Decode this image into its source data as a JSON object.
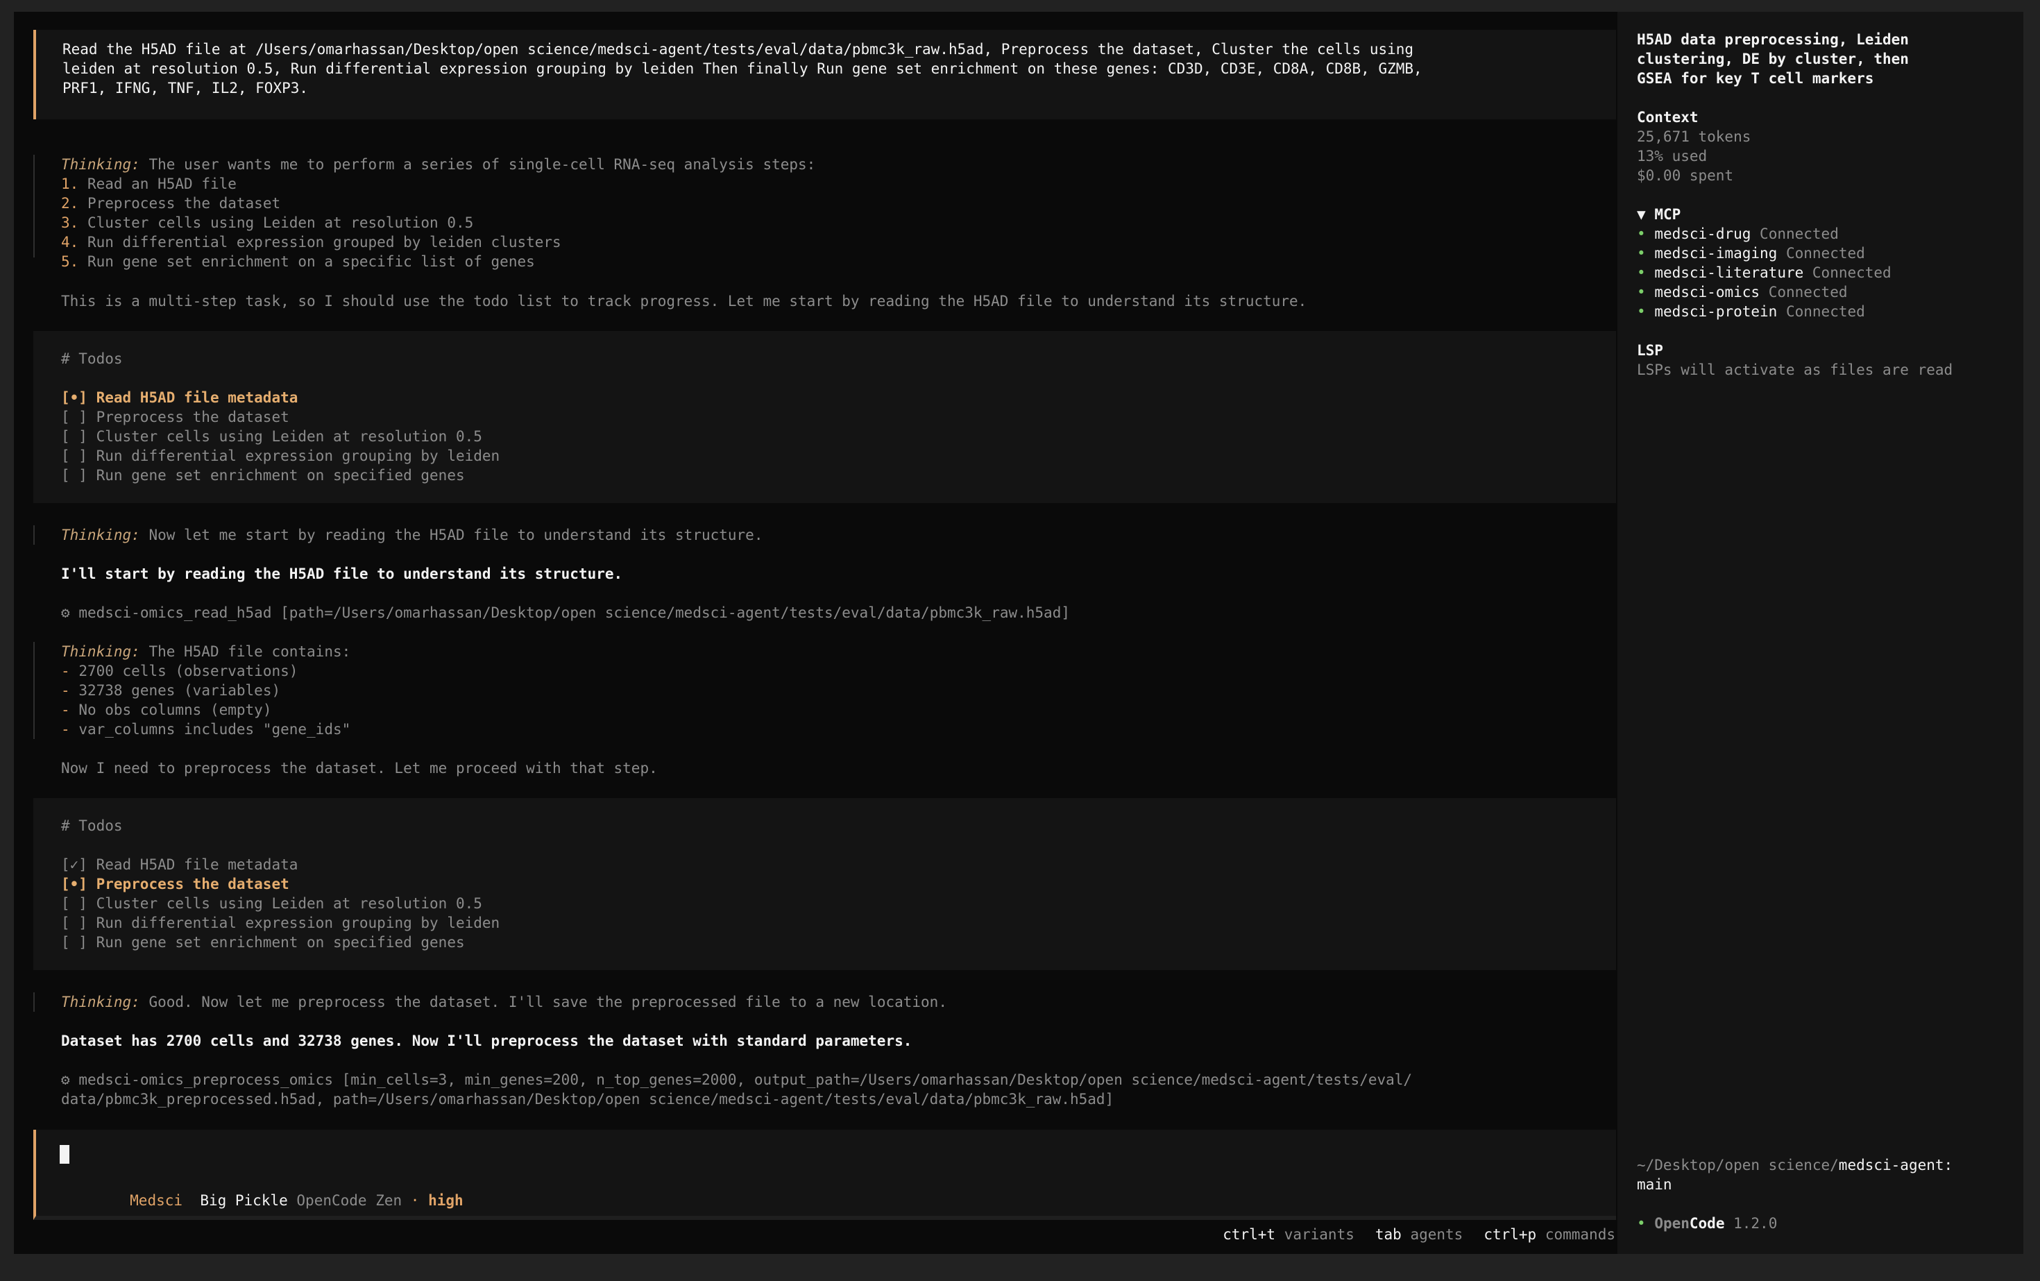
{
  "prompt": {
    "line1": "Read the H5AD file at /Users/omarhassan/Desktop/open science/medsci-agent/tests/eval/data/pbmc3k_raw.h5ad, Preprocess the dataset, Cluster the cells using",
    "line2": "leiden at resolution 0.5, Run differential expression grouping by leiden Then finally Run gene set enrichment on these genes: CD3D, CD3E, CD8A, CD8B, GZMB,",
    "line3": "PRF1, IFNG, TNF, IL2, FOXP3."
  },
  "thinking_label": "Thinking:",
  "thinking1": {
    "intro": "The user wants me to perform a series of single-cell RNA-seq analysis steps:",
    "steps": [
      {
        "num": "1.",
        "text": "Read an H5AD file"
      },
      {
        "num": "2.",
        "text": "Preprocess the dataset"
      },
      {
        "num": "3.",
        "text": "Cluster cells using Leiden at resolution 0.5"
      },
      {
        "num": "4.",
        "text": "Run differential expression grouped by leiden clusters"
      },
      {
        "num": "5.",
        "text": "Run gene set enrichment on a specific list of genes"
      }
    ],
    "outro": "This is a multi-step task, so I should use the todo list to track progress. Let me start by reading the H5AD file to understand its structure."
  },
  "todos1": {
    "header": "# Todos",
    "items": [
      {
        "mark": "[•]",
        "text": "Read H5AD file metadata"
      },
      {
        "mark": "[ ]",
        "text": "Preprocess the dataset"
      },
      {
        "mark": "[ ]",
        "text": "Cluster cells using Leiden at resolution 0.5"
      },
      {
        "mark": "[ ]",
        "text": "Run differential expression grouping by leiden"
      },
      {
        "mark": "[ ]",
        "text": "Run gene set enrichment on specified genes"
      }
    ]
  },
  "thinking2": {
    "text": "Now let me start by reading the H5AD file to understand its structure.",
    "reply": "I'll start by reading the H5AD file to understand its structure.",
    "tool_icon": "⚙",
    "tool": "medsci-omics_read_h5ad [path=/Users/omarhassan/Desktop/open science/medsci-agent/tests/eval/data/pbmc3k_raw.h5ad]"
  },
  "thinking3": {
    "intro": "The H5AD file contains:",
    "bullet": "-",
    "items": [
      "2700 cells (observations)",
      "32738 genes (variables)",
      "No obs columns (empty)",
      "var_columns includes \"gene_ids\""
    ],
    "outro": "Now I need to preprocess the dataset. Let me proceed with that step."
  },
  "todos2": {
    "header": "# Todos",
    "items": [
      {
        "mark": "[✓]",
        "text": "Read H5AD file metadata"
      },
      {
        "mark": "[•]",
        "text": "Preprocess the dataset"
      },
      {
        "mark": "[ ]",
        "text": "Cluster cells using Leiden at resolution 0.5"
      },
      {
        "mark": "[ ]",
        "text": "Run differential expression grouping by leiden"
      },
      {
        "mark": "[ ]",
        "text": "Run gene set enrichment on specified genes"
      }
    ]
  },
  "thinking4": {
    "text": "Good. Now let me preprocess the dataset. I'll save the preprocessed file to a new location.",
    "reply": "Dataset has 2700 cells and 32738 genes. Now I'll preprocess the dataset with standard parameters.",
    "tool_icon": "⚙",
    "tool_line1": "medsci-omics_preprocess_omics [min_cells=3, min_genes=200, n_top_genes=2000, output_path=/Users/omarhassan/Desktop/open science/medsci-agent/tests/eval/",
    "tool_line2": "data/pbmc3k_preprocessed.h5ad, path=/Users/omarhassan/Desktop/open science/medsci-agent/tests/eval/data/pbmc3k_raw.h5ad]"
  },
  "input": {
    "agent": "Medsci",
    "model": "Big Pickle",
    "provider": "OpenCode Zen",
    "sep": "·",
    "effort": "high"
  },
  "footer": {
    "hints": [
      {
        "key": "ctrl+t",
        "label": "variants"
      },
      {
        "key": "tab",
        "label": "agents"
      },
      {
        "key": "ctrl+p",
        "label": "commands"
      }
    ]
  },
  "sidebar": {
    "title_lines": [
      "H5AD data preprocessing, Leiden",
      "clustering, DE by cluster, then",
      "GSEA for key T cell markers"
    ],
    "context": {
      "heading": "Context",
      "tokens": "25,671 tokens",
      "used": "13% used",
      "spent": "$0.00 spent"
    },
    "mcp": {
      "heading": "MCP",
      "toggle": "▼",
      "servers": [
        {
          "name": "medsci-drug",
          "status": "Connected"
        },
        {
          "name": "medsci-imaging",
          "status": "Connected"
        },
        {
          "name": "medsci-literature",
          "status": "Connected"
        },
        {
          "name": "medsci-omics",
          "status": "Connected"
        },
        {
          "name": "medsci-protein",
          "status": "Connected"
        }
      ]
    },
    "lsp": {
      "heading": "LSP",
      "text": "LSPs will activate as files are read"
    },
    "path": {
      "prefix": "~/Desktop/open science/",
      "repo": "medsci-agent:",
      "branch": "main"
    },
    "version": {
      "dot": "•",
      "name_a": "Open",
      "name_b": "Code",
      "number": "1.2.0"
    }
  },
  "colors": {
    "accent": "#e0a367",
    "success": "#7ccf6a",
    "background": "#0a0a0a",
    "panel": "#141414"
  }
}
